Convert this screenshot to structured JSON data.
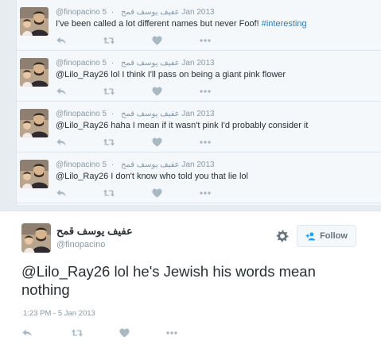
{
  "thread": [
    {
      "handle": "@finopacino",
      "arabic_name": "عفيف يوسف قمح",
      "separator": "·",
      "date": "5 Jan 2013",
      "text": "I've been called a lot different names but never Foof! ",
      "hashtag": "#interesting"
    },
    {
      "handle": "@finopacino",
      "arabic_name": "عفيف يوسف قمح",
      "separator": "·",
      "date": "5 Jan 2013",
      "text": "@Lilo_Ray26 lol I think I'll pass on being a giant pink flower",
      "hashtag": ""
    },
    {
      "handle": "@finopacino",
      "arabic_name": "عفيف يوسف قمح",
      "separator": "·",
      "date": "5 Jan 2013",
      "text": "@Lilo_Ray26 haha I mean if it wasn't pink I'd probably consider it",
      "hashtag": ""
    },
    {
      "handle": "@finopacino",
      "arabic_name": "عفيف يوسف قمح",
      "separator": "·",
      "date": "5 Jan 2013",
      "text": "@Lilo_Ray26 I don't know who told you that lie lol",
      "hashtag": ""
    }
  ],
  "main": {
    "name": "عفيف يوسف قمح",
    "handle": "@finopacino",
    "follow_label": "Follow",
    "text": "@Lilo_Ray26 lol he's Jewish his words mean nothing",
    "timestamp": "1:23 PM - 5 Jan 2013"
  },
  "icons": {
    "reply": "reply-icon",
    "retweet": "retweet-icon",
    "like": "heart-icon",
    "more": "more-dots-icon",
    "settings": "gear-icon",
    "follow": "add-user-icon"
  },
  "colors": {
    "link": "#2b7bb9",
    "muted": "#8899a6",
    "icon": "#aab8c2",
    "text": "#292f33"
  }
}
